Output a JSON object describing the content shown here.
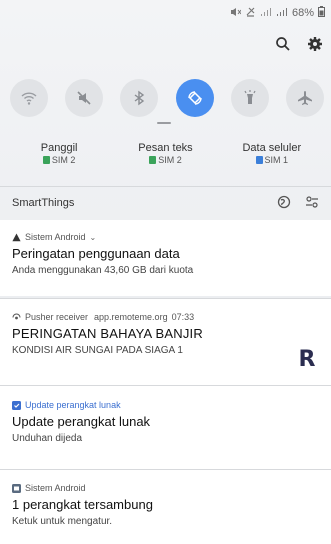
{
  "status_bar": {
    "battery_text": "68%",
    "icons": [
      "mute-icon",
      "alarm-icon",
      "signal-icon",
      "signal-icon",
      "battery-icon"
    ]
  },
  "quick_panel": {
    "actions": [
      "search-icon",
      "settings-gear-icon"
    ],
    "toggles": [
      {
        "name": "wifi",
        "icon": "wifi-icon",
        "active": false
      },
      {
        "name": "sound",
        "icon": "mute-icon",
        "active": false
      },
      {
        "name": "bluetooth",
        "icon": "bluetooth-icon",
        "active": false
      },
      {
        "name": "auto-rotate",
        "icon": "rotate-icon",
        "active": true
      },
      {
        "name": "flashlight",
        "icon": "flashlight-icon",
        "active": false
      },
      {
        "name": "airplane",
        "icon": "airplane-icon",
        "active": false
      }
    ],
    "accent_color": "#4a8ff0",
    "sims": [
      {
        "title": "Panggil",
        "sim": "SIM 2",
        "chip_color": "#3aa35a"
      },
      {
        "title": "Pesan teks",
        "sim": "SIM 2",
        "chip_color": "#3aa35a"
      },
      {
        "title": "Data seluler",
        "sim": "SIM 1",
        "chip_color": "#3b7fd9"
      }
    ],
    "smartthings_label": "SmartThings"
  },
  "notifications": [
    {
      "app": "Sistem Android",
      "icon": "warning-icon",
      "title": "Peringatan penggunaan data",
      "body": "Anda menggunakan 43,60 GB dari kuota"
    },
    {
      "app": "Pusher receiver",
      "source": "app.remoteme.org",
      "time": "07:33",
      "icon": "pusher-icon",
      "title": "PERINGATAN BAHAYA BANJIR",
      "body": "KONDISI AIR SUNGAI PADA SIAGA 1",
      "app_icon_letter": "R"
    },
    {
      "app": "Update perangkat lunak",
      "icon": "update-icon",
      "title": "Update perangkat lunak",
      "body": "Unduhan dijeda",
      "app_color": "#3b6fd0"
    },
    {
      "app": "Sistem Android",
      "icon": "android-system-icon",
      "title": "1 perangkat tersambung",
      "body": "Ketuk untuk mengatur."
    }
  ]
}
